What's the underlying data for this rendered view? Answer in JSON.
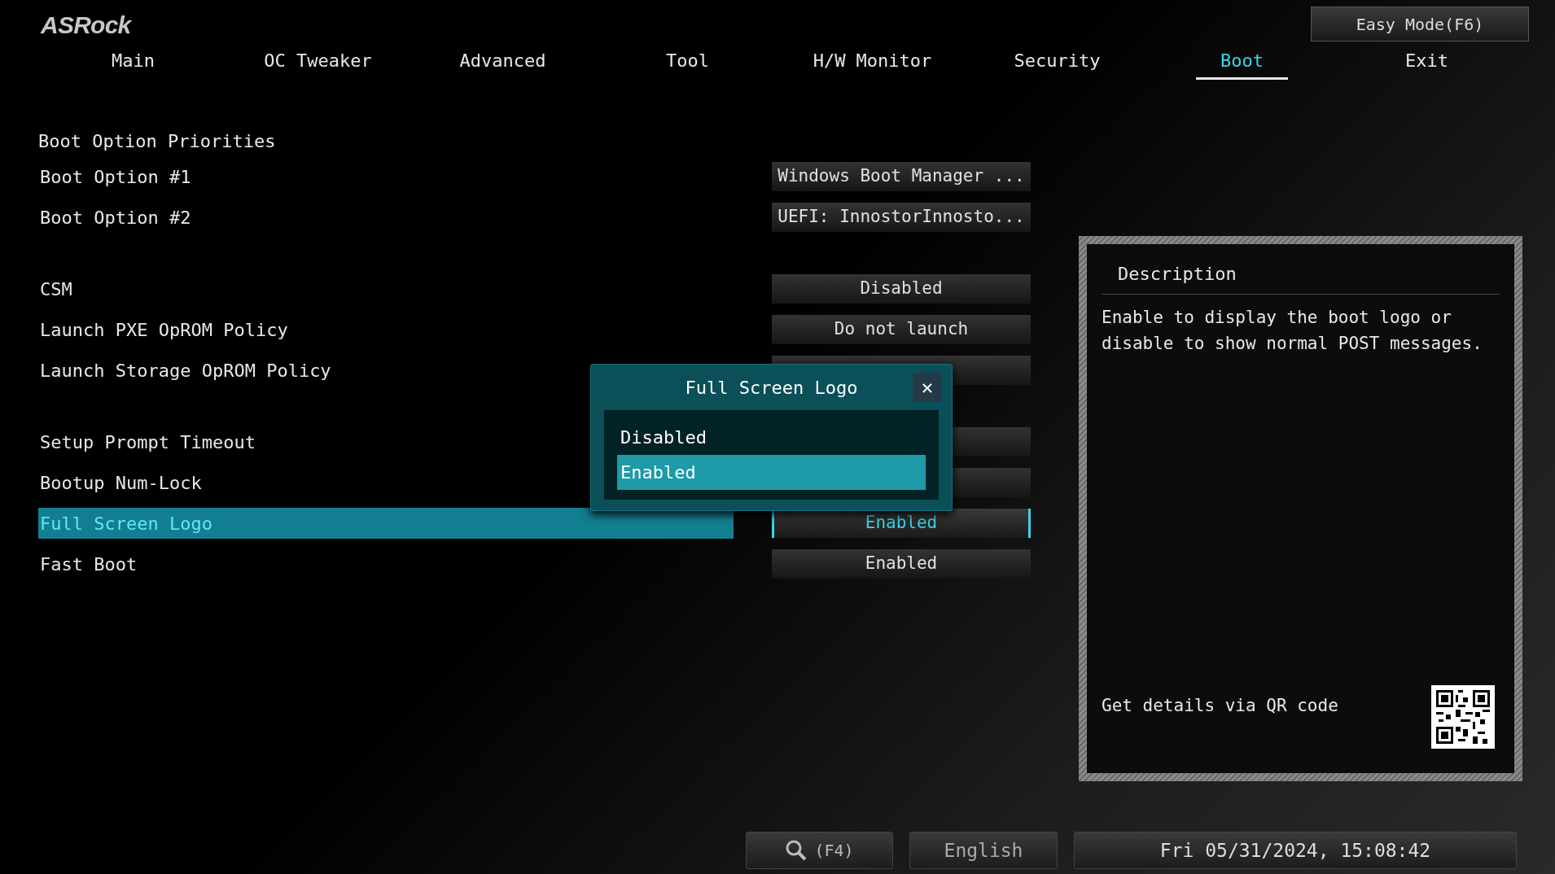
{
  "logo": "ASRock",
  "easy_mode_button": "Easy Mode(F6)",
  "tabs": [
    {
      "label": "Main",
      "selected": false
    },
    {
      "label": "OC Tweaker",
      "selected": false
    },
    {
      "label": "Advanced",
      "selected": false
    },
    {
      "label": "Tool",
      "selected": false
    },
    {
      "label": "H/W Monitor",
      "selected": false
    },
    {
      "label": "Security",
      "selected": false
    },
    {
      "label": "Boot",
      "selected": true
    },
    {
      "label": "Exit",
      "selected": false
    }
  ],
  "sections": [
    {
      "heading": "Boot Option Priorities",
      "items": [
        {
          "label": "Boot Option #1",
          "value": "Windows Boot Manager ...",
          "selected": false
        },
        {
          "label": "Boot Option #2",
          "value": "UEFI: InnostorInnosto...",
          "selected": false
        }
      ]
    },
    {
      "items": [
        {
          "label": "CSM",
          "value": "Disabled",
          "selected": false
        },
        {
          "label": "Launch PXE OpROM Policy",
          "value": "Do not launch",
          "selected": false
        },
        {
          "label": "Launch Storage OpROM Policy",
          "selected": false
        }
      ]
    },
    {
      "items": [
        {
          "label": "Setup Prompt Timeout",
          "selected": false
        },
        {
          "label": "Bootup Num-Lock",
          "selected": false
        },
        {
          "label": "Full Screen Logo",
          "value": "Enabled",
          "selected": true
        },
        {
          "label": "Fast Boot",
          "value": "Enabled",
          "selected": false
        }
      ]
    }
  ],
  "popup": {
    "title": "Full Screen Logo",
    "close": "✕",
    "options": [
      {
        "label": "Disabled",
        "selected": false
      },
      {
        "label": "Enabled",
        "selected": true
      }
    ]
  },
  "description": {
    "title": "Description",
    "text": "Enable to display the boot logo or disable to show normal POST messages.",
    "qr_label": "Get details via QR code"
  },
  "status_bar": {
    "search_key": "(F4)",
    "language": "English",
    "datetime": "Fri 05/31/2024, 15:08:42"
  }
}
